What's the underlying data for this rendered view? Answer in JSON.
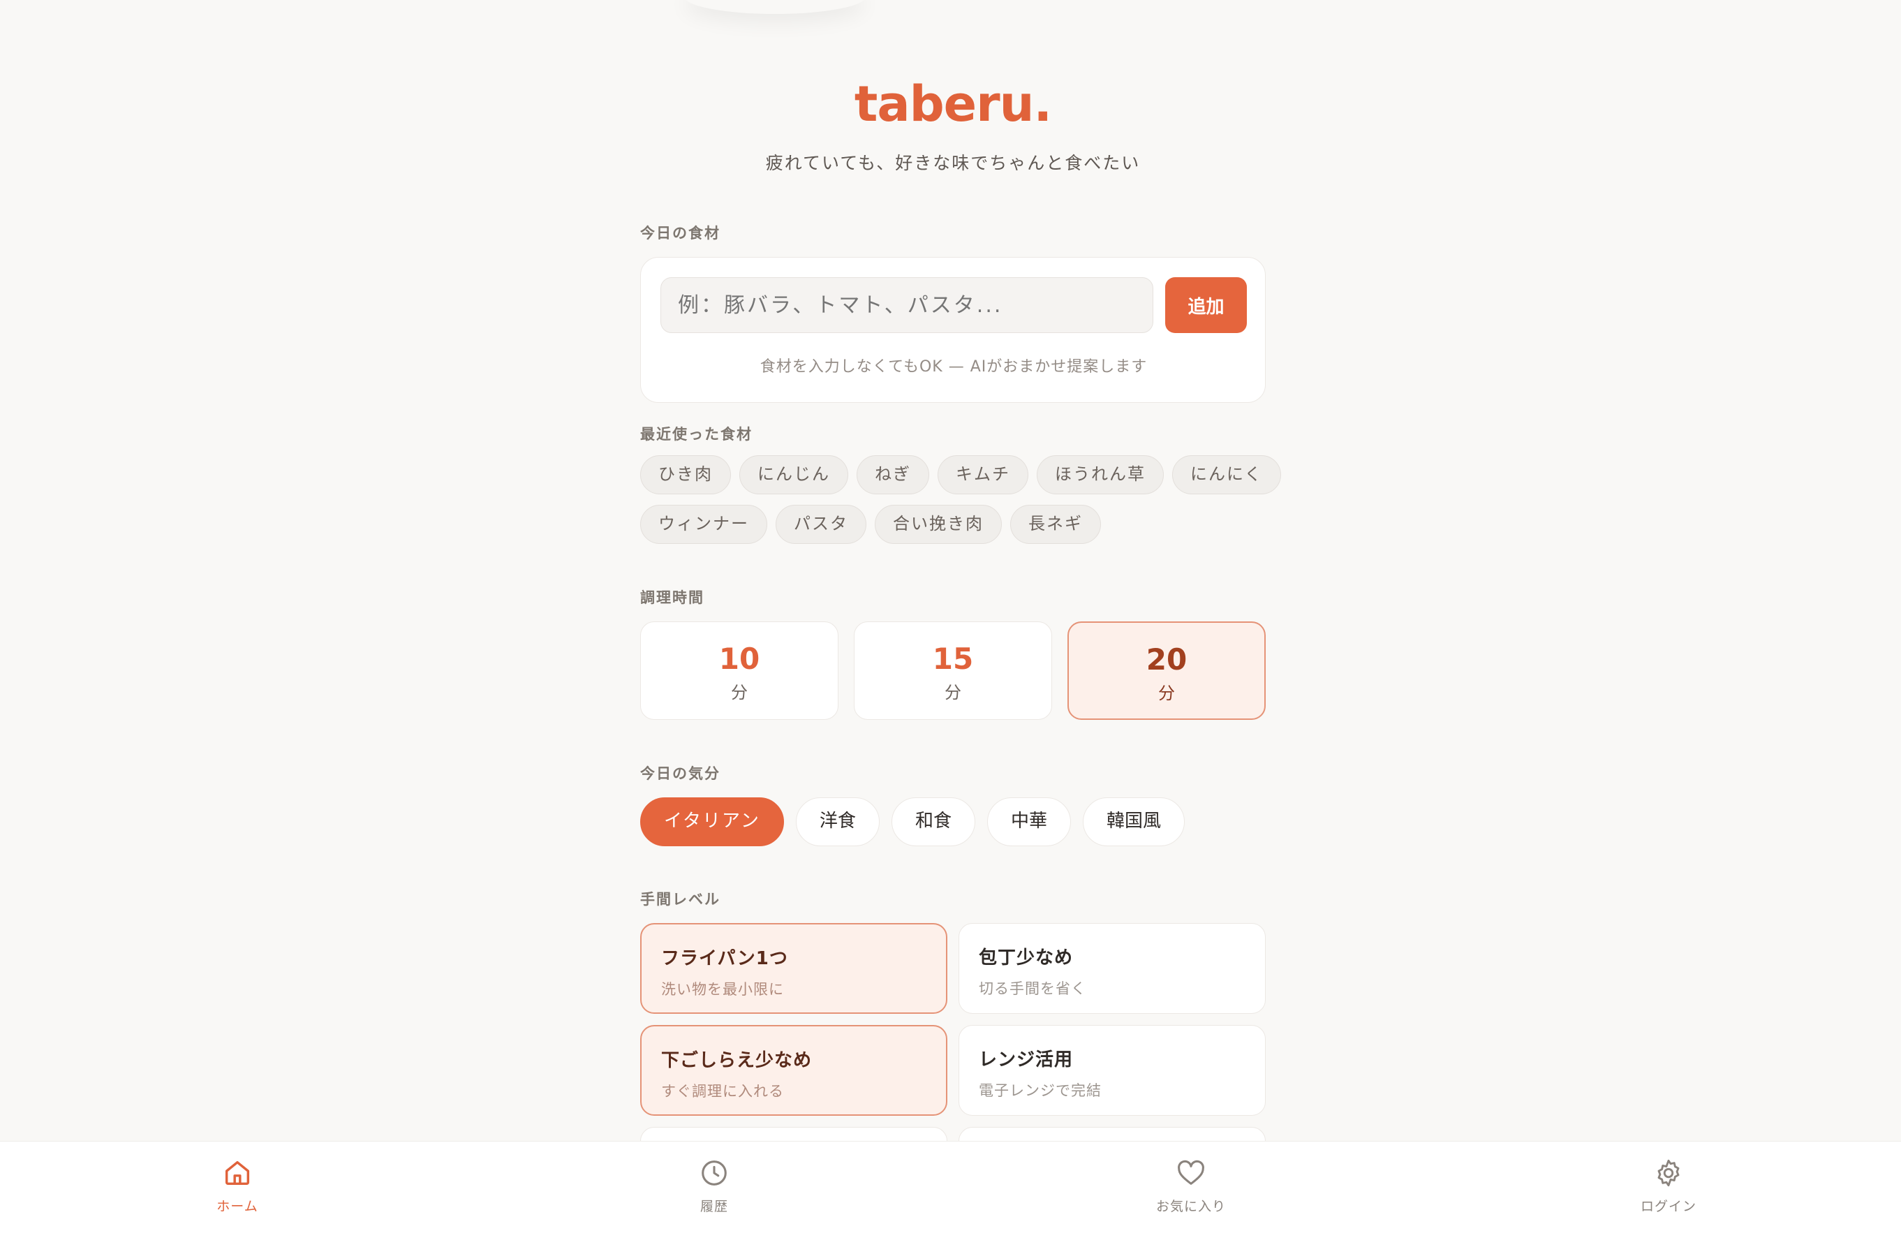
{
  "app": {
    "logo": "taberu.",
    "tagline": "疲れていても、好きな味でちゃんと食べたい"
  },
  "ingredients": {
    "section_label": "今日の食材",
    "placeholder": "例：豚バラ、トマト、パスタ...",
    "add_label": "追加",
    "hint": "食材を入力しなくてもOK — AIがおまかせ提案します"
  },
  "recent": {
    "section_label": "最近使った食材",
    "row1": [
      "ひき肉",
      "にんじん",
      "ねぎ",
      "キムチ",
      "ほうれん草",
      "にんにく"
    ],
    "row2": [
      "ウィンナー",
      "パスタ",
      "合い挽き肉",
      "長ネギ"
    ]
  },
  "time": {
    "section_label": "調理時間",
    "options": [
      {
        "value": "10",
        "unit": "分"
      },
      {
        "value": "15",
        "unit": "分"
      },
      {
        "value": "20",
        "unit": "分"
      }
    ],
    "selected": "20"
  },
  "mood": {
    "section_label": "今日の気分",
    "options": [
      "イタリアン",
      "洋食",
      "和食",
      "中華",
      "韓国風"
    ],
    "selected": "イタリアン"
  },
  "effort": {
    "section_label": "手間レベル",
    "options": [
      {
        "title": "フライパン1つ",
        "desc": "洗い物を最小限に",
        "selected": true
      },
      {
        "title": "包丁少なめ",
        "desc": "切る手間を省く",
        "selected": false
      },
      {
        "title": "下ごしらえ少なめ",
        "desc": "すぐ調理に入れる",
        "selected": true
      },
      {
        "title": "レンジ活用",
        "desc": "電子レンジで完結",
        "selected": false
      }
    ]
  },
  "nav": {
    "items": [
      {
        "label": "ホーム",
        "icon": "home-icon",
        "active": true
      },
      {
        "label": "履歴",
        "icon": "clock-icon",
        "active": false
      },
      {
        "label": "お気に入り",
        "icon": "heart-icon",
        "active": false
      },
      {
        "label": "ログイン",
        "icon": "gear-icon",
        "active": false
      }
    ]
  },
  "colors": {
    "accent": "#e5653d",
    "background": "#f9f8f6",
    "selected_bg": "#fdf0ea"
  }
}
